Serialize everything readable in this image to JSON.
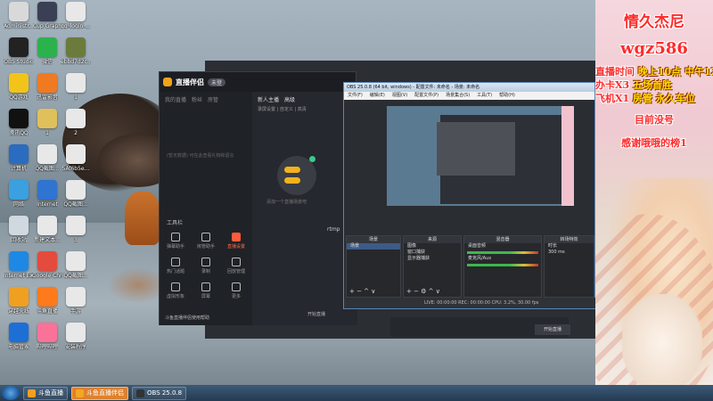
{
  "desktop": {
    "icons": [
      {
        "label": "Administr...",
        "color": "#d9d9d9"
      },
      {
        "label": "Cup Graph",
        "color": "#3a3f55"
      },
      {
        "label": "qq_login_...",
        "color": "#e8e8e8"
      },
      {
        "label": "OBS Studio",
        "color": "#222222"
      },
      {
        "label": "微信",
        "color": "#2bb24c"
      },
      {
        "label": "ebbd7d2c...",
        "color": "#6b7b3c"
      },
      {
        "label": "QQ游戏",
        "color": "#f2c41a"
      },
      {
        "label": "迅雷影音",
        "color": "#f07a22"
      },
      {
        "label": "1",
        "color": "#e8e8e8"
      },
      {
        "label": "腾讯QQ",
        "color": "#111111"
      },
      {
        "label": "1",
        "color": "#e0c05a"
      },
      {
        "label": "2",
        "color": "#e8e8e8"
      },
      {
        "label": "计算机",
        "color": "#2a6cbf"
      },
      {
        "label": "QQ截图...",
        "color": "#e8e8e8"
      },
      {
        "label": "5Af6b5e...",
        "color": "#e8e8e8"
      },
      {
        "label": "网络",
        "color": "#3aa0e0"
      },
      {
        "label": "Internet",
        "color": "#2f74d0"
      },
      {
        "label": "QQ截图...",
        "color": "#e8e8e8"
      },
      {
        "label": "回收站",
        "color": "#d0d8e0"
      },
      {
        "label": "新建文本...",
        "color": "#e8e8e8"
      },
      {
        "label": "3",
        "color": "#e8e8e8"
      },
      {
        "label": "Internet Explorer",
        "color": "#1e88e5"
      },
      {
        "label": "Google Chrome",
        "color": "#e44b3c"
      },
      {
        "label": "QQ截图...",
        "color": "#e8e8e8"
      },
      {
        "label": "穿越火线",
        "color": "#f0a020"
      },
      {
        "label": "斗鱼直播",
        "color": "#ff7a1a"
      },
      {
        "label": "手游",
        "color": "#e8e8e8"
      },
      {
        "label": "电脑管家",
        "color": "#1d6fd6"
      },
      {
        "label": "哔哩哔哩",
        "color": "#fb7299"
      },
      {
        "label": "安装程序",
        "color": "#e8e8e8"
      }
    ]
  },
  "overlay": {
    "title": "情久杰尼",
    "id": "wgz586",
    "schedule_label": "直播时间",
    "schedule_value": "晚上10点 中午12点",
    "card_label": "办卡X3",
    "card_value": "五场首胜",
    "plane_label": "飞机X1",
    "plane_value": "房管 永久车位",
    "status": "目前没号",
    "thanks": "感谢哦哦的榜1"
  },
  "zhibo": {
    "title": "直播伴侣",
    "badge": "未登",
    "left_tabs": [
      "我的直播",
      "粉丝",
      "房管"
    ],
    "empty_hint": "(暂无数据) 可在此查看礼物和留言",
    "tools_heading": "工具栏",
    "tools": [
      "弹幕助手",
      "房管助手",
      "直播设置",
      "热门话题",
      "录制",
      "回放管理",
      "虚拟形象",
      "屏幕",
      "更多"
    ],
    "center_tabs": [
      "新人主播",
      "高级",
      "工具",
      "添加"
    ],
    "mode_label": "录屏设置 | 自定义 | 高清",
    "center_hint": "添加一个直播场景吧",
    "bottom_left": "斗鱼直播伴侣使用帮助",
    "bottom_center": "开始直播"
  },
  "obs": {
    "title": "OBS 25.0.8 (64 bit, windows) - 配置文件: 未命名 - 场景: 未命名",
    "menu": [
      "文件(F)",
      "编辑(E)",
      "视图(V)",
      "配置文件(P)",
      "场景集合(S)",
      "工具(T)",
      "帮助(H)"
    ],
    "docks": {
      "scenes": {
        "title": "场景",
        "items": [
          "场景"
        ]
      },
      "sources": {
        "title": "来源",
        "items": [
          "图像",
          "窗口捕获",
          "显示器捕获"
        ]
      },
      "mixer": {
        "title": "混音器",
        "channels": [
          "桌面音频",
          "麦克风/Aux"
        ]
      },
      "transitions": {
        "title": "转场特效",
        "duration_label": "时长",
        "duration_value": "300 ms"
      }
    },
    "status": "LIVE: 00:00:00   REC: 00:00:00   CPU: 3.2%, 30.00 fps",
    "start_button": "开始直播",
    "rtmp": "rtmp"
  },
  "taskbar": {
    "items": [
      {
        "label": "斗鱼直播",
        "color": "#f0a020",
        "active": false
      },
      {
        "label": "斗鱼直播伴侣",
        "color": "#f5a623",
        "active": true
      },
      {
        "label": "OBS 25.0.8",
        "color": "#333333",
        "active": false
      }
    ]
  }
}
